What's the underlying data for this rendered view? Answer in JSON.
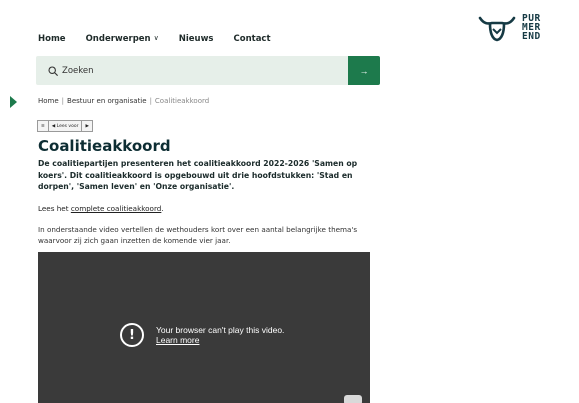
{
  "nav": {
    "items": [
      {
        "label": "Home"
      },
      {
        "label": "Onderwerpen",
        "chevron": "∨"
      },
      {
        "label": "Nieuws"
      },
      {
        "label": "Contact"
      }
    ]
  },
  "logo": {
    "lines": [
      "PUR",
      "MER",
      "END"
    ],
    "icon": "cow-head-icon",
    "color": "#163a44"
  },
  "search": {
    "placeholder": "Zoeken",
    "button_glyph": "→"
  },
  "breadcrumb": {
    "items": [
      "Home",
      "Bestuur en organisatie",
      "Coalitieakkoord"
    ],
    "separator": "|"
  },
  "readspeaker": {
    "menu_glyph": "≡",
    "label": "◀ Lees voor",
    "play_glyph": "▶"
  },
  "article": {
    "title": "Coalitieakkoord",
    "intro": "De coalitiepartijen presenteren het coalitieakkoord 2022-2026 'Samen op koers'. Dit coalitieakkoord is opgebouwd uit drie hoofdstukken: 'Stad en dorpen', 'Samen leven' en 'Onze organisatie'.",
    "lees_prefix": "Lees het ",
    "lees_link": "complete coalitieakkoord",
    "lees_suffix": ".",
    "description": "In onderstaande video vertellen de wethouders kort over een aantal belangrijke thema's waarvoor zij zich gaan inzetten de komende vier jaar."
  },
  "video": {
    "error_glyph": "!",
    "error_message": "Your browser can't play this video.",
    "learn_more": "Learn more"
  },
  "colors": {
    "accent": "#1d7a4c",
    "search_bg": "#e6efe9",
    "title": "#0d2d33",
    "video_bg": "#3a3a3a"
  }
}
